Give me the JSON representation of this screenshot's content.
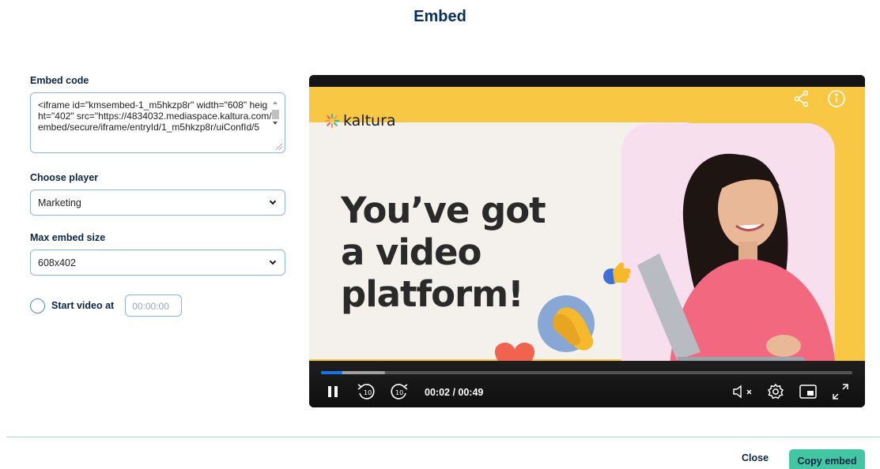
{
  "dialog": {
    "title": "Embed"
  },
  "embed_code": {
    "label": "Embed code",
    "value": "<iframe id=\"kmsembed-1_m5hkzp8r\" width=\"608\" height=\"402\" src=\"https://4834032.mediaspace.kaltura.com/embed/secure/iframe/entryId/1_m5hkzp8r/uiConfId/5"
  },
  "player": {
    "label": "Choose player",
    "selected": "Marketing"
  },
  "embed_size": {
    "label": "Max embed size",
    "selected": "608x402"
  },
  "start_video": {
    "label": "Start video at",
    "checked": false,
    "time_placeholder": "00:00:00"
  },
  "video": {
    "brand": "kaltura",
    "headline_lines": [
      "You’ve got",
      "a video",
      "platform!"
    ],
    "current_time": "00:02",
    "duration": "00:49",
    "time_display": "00:02 / 00:49",
    "progress_fraction": 0.04,
    "skip_seconds": "10",
    "accent_color": "#f8c845",
    "icons": [
      "share-icon",
      "info-icon",
      "pause-icon",
      "rewind-10-icon",
      "forward-10-icon",
      "mute-icon",
      "settings-icon",
      "picture-in-picture-icon",
      "fullscreen-icon"
    ]
  },
  "footer": {
    "close_label": "Close",
    "copy_label": "Copy embed",
    "copy_color": "#43c7a3"
  }
}
